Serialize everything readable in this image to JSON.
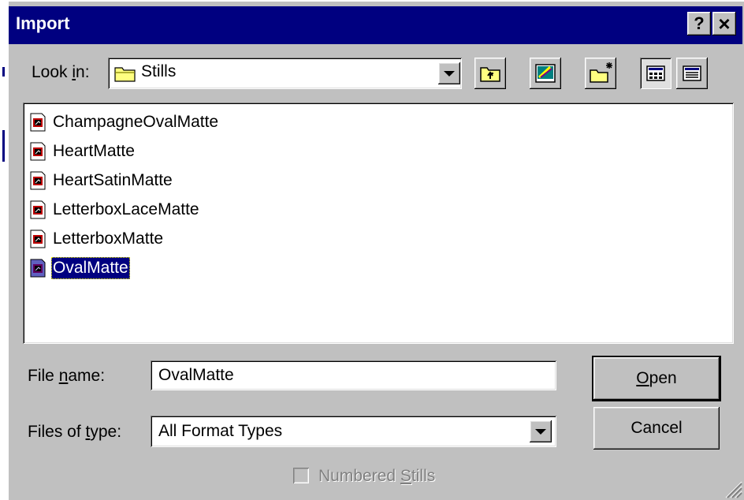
{
  "window": {
    "title": "Import",
    "help_button": "?",
    "close_button": "×"
  },
  "lookin": {
    "label_pre": "Look ",
    "label_mnemonic": "i",
    "label_post": "n:",
    "value": "Stills"
  },
  "toolbar": {
    "icons": [
      "up-one-level-icon",
      "desktop-icon",
      "create-new-folder-icon",
      "list-view-icon",
      "details-view-icon"
    ]
  },
  "files": [
    "ChampagneOvalMatte",
    "HeartMatte",
    "HeartSatinMatte",
    "LetterboxLaceMatte",
    "LetterboxMatte",
    "OvalMatte"
  ],
  "selected_file": "OvalMatte",
  "filename": {
    "label_pre": "File ",
    "label_mnemonic": "n",
    "label_post": "ame:",
    "value": "OvalMatte"
  },
  "filetype": {
    "label_pre": "Files of ",
    "label_mnemonic": "t",
    "label_post": "ype:",
    "value": "All Format Types"
  },
  "buttons": {
    "open_mnemonic": "O",
    "open_rest": "pen",
    "cancel": "Cancel"
  },
  "numbered_stills": {
    "label_pre": "Numbered ",
    "label_mnemonic": "S",
    "label_post": "tills",
    "checked": false,
    "enabled": false
  },
  "colors": {
    "titlebar": "#000080",
    "face": "#c0c0c0",
    "selection": "#000080",
    "file_icon": "#c00000"
  }
}
